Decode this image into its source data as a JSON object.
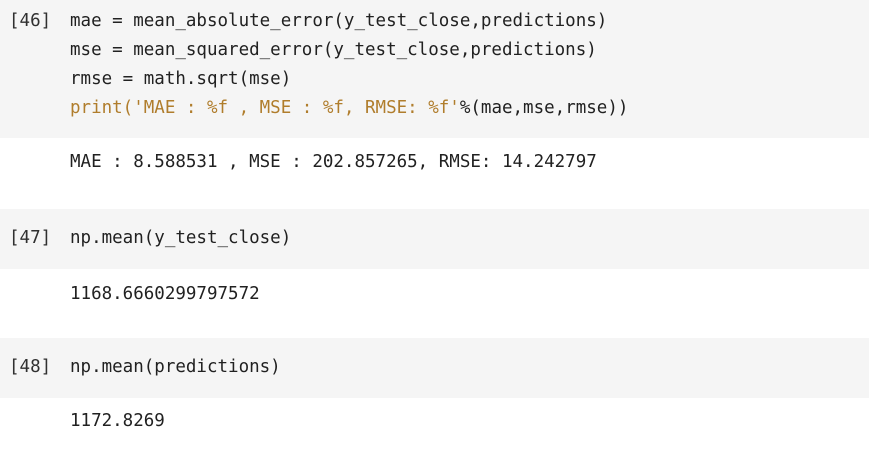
{
  "cells": [
    {
      "prompt": "[46]",
      "code_lines": [
        "mae = mean_absolute_error(y_test_close,predictions)",
        "mse = mean_squared_error(y_test_close,predictions)",
        "rmse = math.sqrt(mse)"
      ],
      "print_line": {
        "prefix": "print(",
        "string": "'MAE : %f , MSE : %f, RMSE: %f'",
        "suffix": "%(mae,mse,rmse))"
      },
      "output": "MAE : 8.588531 , MSE : 202.857265, RMSE: 14.242797"
    },
    {
      "prompt": "[47]",
      "code_lines": [
        "np.mean(y_test_close)"
      ],
      "output": "1168.6660299797572"
    },
    {
      "prompt": "[48]",
      "code_lines": [
        "np.mean(predictions)"
      ],
      "output": "1172.8269"
    }
  ],
  "colors": {
    "input_background": "#f5f5f5",
    "string_literal": "#b07d2c",
    "code_text": "#212121"
  }
}
